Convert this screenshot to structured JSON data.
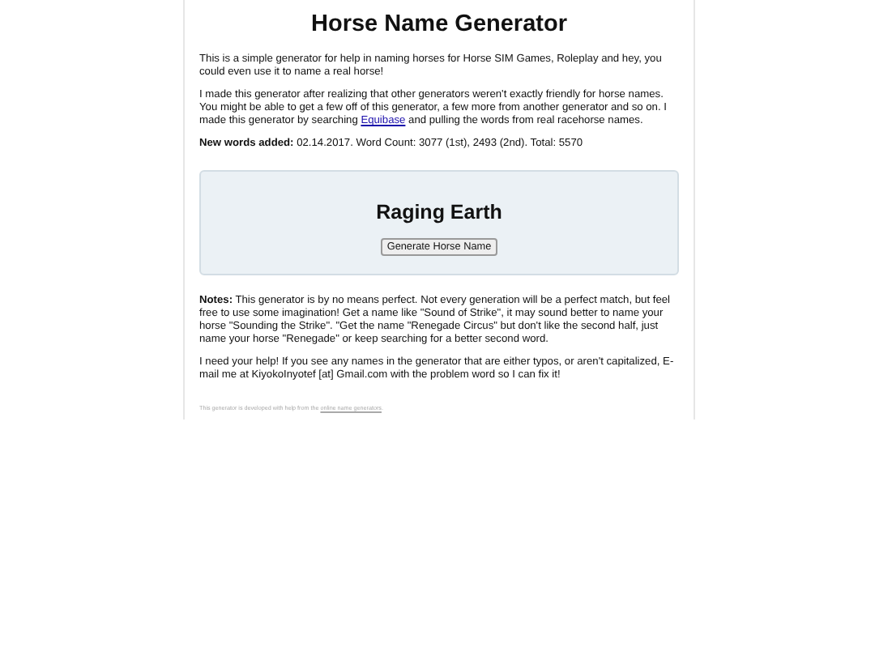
{
  "title": "Horse Name Generator",
  "intro": "This is a simple generator for help in naming horses for Horse SIM Games, Roleplay and hey, you could even use it to name a real horse!",
  "about": {
    "before": "I made this generator after realizing that other generators weren't exactly friendly for horse names. You might be able to get a few off of this generator, a few more from another generator and so on. I made this generator by searching ",
    "link": "Equibase",
    "after": " and pulling the words from real racehorse names."
  },
  "stats": "**New words added:** 02.14.2017. Word Count: 3077 (1st), 2493 (2nd). Total: 5570",
  "generator": {
    "result": "Raging Earth",
    "button": "Generate Horse Name"
  },
  "notes": "**Notes:** This generator is by no means perfect. Not every generation will be a perfect match, but feel free to use some imagination! Get a name like \"Sound of Strike\", it may sound better to name your horse \"Sounding the Strike\". \"Get the name \"Renegade Circus\" but don't like the second half, just name your horse \"Renegade\" or keep searching for a better second word.",
  "help": "I need your help! If you see any names in the generator that are either typos, or aren't capitalized, E-mail me at KiyokoInyotef [at] Gmail.com with the problem word so I can fix it!",
  "footer": {
    "before": "This generator is developed with help from the ",
    "link": "online name generators",
    "after": "."
  }
}
